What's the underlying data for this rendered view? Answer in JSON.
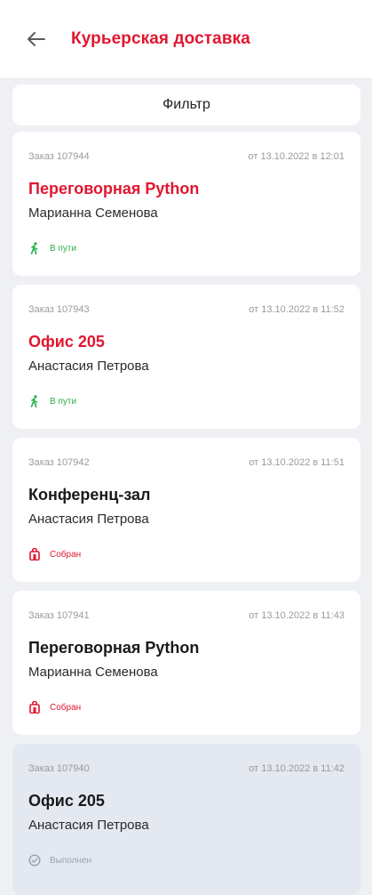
{
  "header": {
    "title": "Курьерская доставка"
  },
  "filter": {
    "label": "Фильтр"
  },
  "colors": {
    "accent": "#e0172f",
    "status_in_transit": "#27b24a",
    "status_collected": "#e0172f",
    "status_done": "#98a3b3"
  },
  "orders": [
    {
      "order_label": "Заказ 107944",
      "date_label": "от 13.10.2022 в 12:01",
      "room": "Переговорная Python",
      "person": "Марианна Семенова",
      "status": "В пути",
      "status_icon": "walking-person-icon"
    },
    {
      "order_label": "Заказ 107943",
      "date_label": "от 13.10.2022 в 11:52",
      "room": "Офис 205",
      "person": "Анастасия Петрова",
      "status": "В пути",
      "status_icon": "walking-person-icon"
    },
    {
      "order_label": "Заказ 107942",
      "date_label": "от 13.10.2022 в 11:51",
      "room": "Конференц-зал",
      "person": "Анастасия Петрова",
      "status": "Собран",
      "status_icon": "bag-icon"
    },
    {
      "order_label": "Заказ 107941",
      "date_label": "от 13.10.2022 в 11:43",
      "room": "Переговорная Python",
      "person": "Марианна Семенова",
      "status": "Собран",
      "status_icon": "bag-icon"
    },
    {
      "order_label": "Заказ 107940",
      "date_label": "от 13.10.2022 в 11:42",
      "room": "Офис 205",
      "person": "Анастасия Петрова",
      "status": "Выполнен",
      "status_icon": "check-circle-icon"
    }
  ]
}
